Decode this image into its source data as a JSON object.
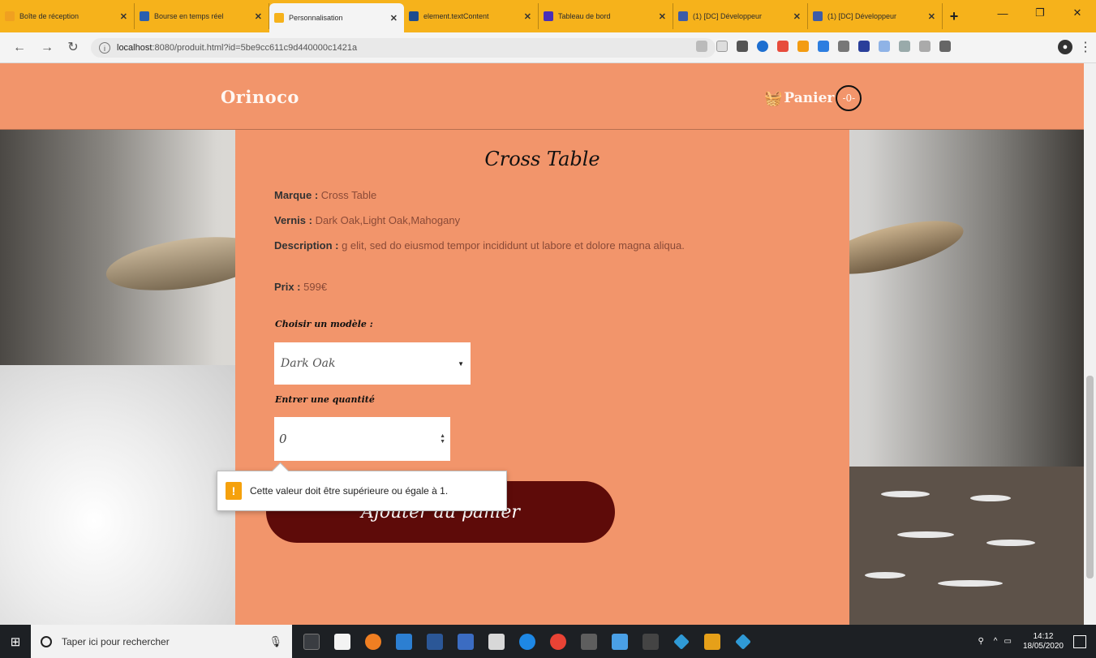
{
  "browser": {
    "tabs": [
      {
        "title": "Boîte de réception",
        "color": "#f0a020"
      },
      {
        "title": "Bourse en temps réel",
        "color": "#2a5fb0"
      },
      {
        "title": "Personnalisation",
        "color": "#f6b21b",
        "active": true
      },
      {
        "title": "element.textContent",
        "color": "#1d4c8f"
      },
      {
        "title": "Tableau de bord",
        "color": "#4a2fb7"
      },
      {
        "title": "(1) [DC] Développeur",
        "color": "#3d5ca8"
      },
      {
        "title": "(1) [DC] Développeur",
        "color": "#3d5ca8"
      }
    ],
    "new_tab": "+",
    "url_host": "localhost",
    "url_rest": ":8080/produit.html?id=5be9cc611c9d440000c1421a"
  },
  "site": {
    "brand": "Orinoco",
    "cart_label": "Panier",
    "cart_count": "0"
  },
  "product": {
    "title": "Cross Table",
    "brand_label": "Marque :",
    "brand_value": "Cross Table",
    "varnish_label": "Vernis :",
    "varnish_value": "Dark Oak,Light Oak,Mahogany",
    "description_label": "Description :",
    "description_value": "g elit, sed do eiusmod tempor incididunt ut labore et dolore magna aliqua.",
    "price_label": "Prix :",
    "price_value": "599€",
    "model_label": "Choisir un modèle :",
    "model_selected": "Dark Oak",
    "quantity_label": "Entrer une quantité",
    "quantity_value": "0",
    "add_button": "Ajouter au panier",
    "validation_message": "Cette valeur doit être supérieure ou égale à 1."
  },
  "taskbar": {
    "search_placeholder": "Taper ici pour rechercher",
    "time": "14:12",
    "date": "18/05/2020"
  }
}
